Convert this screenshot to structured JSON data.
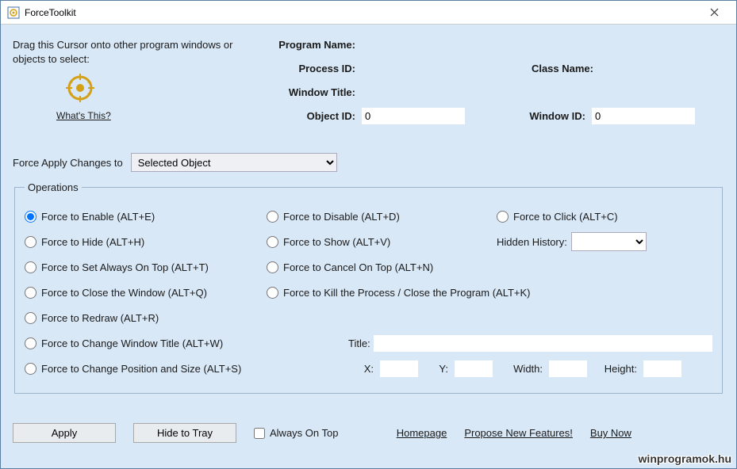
{
  "window": {
    "title": "ForceToolkit",
    "close_tooltip": "Close"
  },
  "cursor_block": {
    "text": "Drag this Cursor onto other program windows or objects to select:",
    "whats_this": "What's This?"
  },
  "info": {
    "program_name_label": "Program Name:",
    "program_name_value": "",
    "process_id_label": "Process ID:",
    "process_id_value": "",
    "class_name_label": "Class Name:",
    "class_name_value": "",
    "window_title_label": "Window Title:",
    "window_title_value": "",
    "object_id_label": "Object ID:",
    "object_id_value": "0",
    "window_id_label": "Window ID:",
    "window_id_value": "0"
  },
  "apply_to": {
    "label": "Force Apply Changes to",
    "selected": "Selected Object"
  },
  "ops": {
    "legend": "Operations",
    "enable": "Force to Enable (ALT+E)",
    "disable": "Force to Disable (ALT+D)",
    "click": "Force to Click (ALT+C)",
    "hide": "Force to Hide (ALT+H)",
    "show": "Force to Show (ALT+V)",
    "hidden_history_label": "Hidden History:",
    "hidden_history_value": "",
    "always_top": "Force to Set Always On Top (ALT+T)",
    "cancel_top": "Force to Cancel On Top (ALT+N)",
    "close_window": "Force to Close the Window (ALT+Q)",
    "kill_process": "Force to Kill the Process / Close the Program (ALT+K)",
    "redraw": "Force to Redraw (ALT+R)",
    "change_title": "Force to Change Window Title (ALT+W)",
    "title_label": "Title:",
    "title_value": "",
    "change_pos": "Force to Change Position and Size (ALT+S)",
    "x_label": "X:",
    "x_value": "",
    "y_label": "Y:",
    "y_value": "",
    "w_label": "Width:",
    "w_value": "",
    "h_label": "Height:",
    "h_value": ""
  },
  "bottom": {
    "apply": "Apply",
    "hide_to_tray": "Hide to Tray",
    "always_on_top": "Always On Top",
    "homepage": "Homepage",
    "propose": "Propose New Features!",
    "buy": "Buy Now"
  },
  "watermark": "winprogramok.hu"
}
